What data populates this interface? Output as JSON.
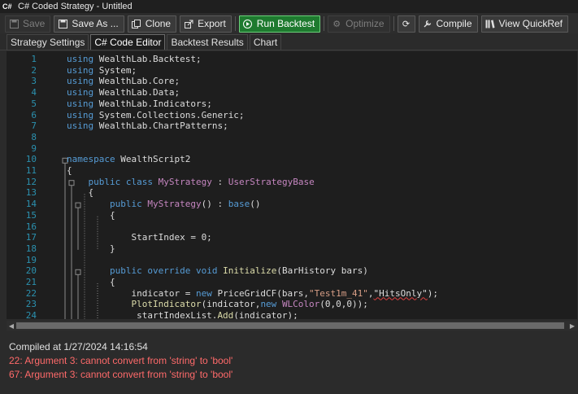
{
  "window": {
    "title": "C# Coded Strategy - Untitled",
    "icon": "csharp-app-icon"
  },
  "toolbar": {
    "save": "Save",
    "save_as": "Save As ...",
    "clone": "Clone",
    "export": "Export",
    "run_backtest": "Run Backtest",
    "optimize": "Optimize",
    "compile": "Compile",
    "view_quickref": "View QuickRef"
  },
  "tabs": [
    "Strategy Settings",
    "C# Code Editor",
    "Backtest Results",
    "Chart"
  ],
  "active_tab": "C# Code Editor",
  "code": {
    "line_numbers": [
      "1",
      "2",
      "3",
      "4",
      "5",
      "6",
      "7",
      "8",
      "9",
      "10",
      "11",
      "12",
      "13",
      "14",
      "15",
      "16",
      "17",
      "18",
      "19",
      "20",
      "21",
      "22",
      "23",
      "24"
    ],
    "lines": [
      [
        [
          "kw",
          "using"
        ],
        [
          "pu",
          " WealthLab.Backtest;"
        ]
      ],
      [
        [
          "kw",
          "using"
        ],
        [
          "pu",
          " System;"
        ]
      ],
      [
        [
          "kw",
          "using"
        ],
        [
          "pu",
          " WealthLab.Core;"
        ]
      ],
      [
        [
          "kw",
          "using"
        ],
        [
          "pu",
          " WealthLab.Data;"
        ]
      ],
      [
        [
          "kw",
          "using"
        ],
        [
          "pu",
          " WealthLab.Indicators;"
        ]
      ],
      [
        [
          "kw",
          "using"
        ],
        [
          "pu",
          " System.Collections.Generic;"
        ]
      ],
      [
        [
          "kw",
          "using"
        ],
        [
          "pu",
          " WealthLab.ChartPatterns;"
        ]
      ],
      [],
      [],
      [
        [
          "kw",
          "namespace"
        ],
        [
          "pu",
          " WealthScript2"
        ]
      ],
      [
        [
          "pu",
          "{"
        ]
      ],
      [
        [
          "pu",
          "    "
        ],
        [
          "kw",
          "public"
        ],
        [
          "pu",
          " "
        ],
        [
          "kw",
          "class"
        ],
        [
          "pu",
          " "
        ],
        [
          "ts",
          "MyStrategy"
        ],
        [
          "pu",
          " : "
        ],
        [
          "ts",
          "UserStrategyBase"
        ]
      ],
      [
        [
          "pu",
          "    {"
        ]
      ],
      [
        [
          "pu",
          "        "
        ],
        [
          "kw",
          "public"
        ],
        [
          "pu",
          " "
        ],
        [
          "ts",
          "MyStrategy"
        ],
        [
          "pu",
          "() : "
        ],
        [
          "kw",
          "base"
        ],
        [
          "pu",
          "()"
        ]
      ],
      [
        [
          "pu",
          "        {"
        ]
      ],
      [],
      [
        [
          "pu",
          "            StartIndex = 0;"
        ]
      ],
      [
        [
          "pu",
          "        }"
        ]
      ],
      [],
      [
        [
          "pu",
          "        "
        ],
        [
          "kw",
          "public"
        ],
        [
          "pu",
          " "
        ],
        [
          "kw",
          "override"
        ],
        [
          "pu",
          " "
        ],
        [
          "kw",
          "void"
        ],
        [
          "pu",
          " "
        ],
        [
          "nm",
          "Initialize"
        ],
        [
          "pu",
          "(BarHistory bars)"
        ]
      ],
      [
        [
          "pu",
          "        {"
        ]
      ],
      [
        [
          "pu",
          "            indicator = "
        ],
        [
          "kw",
          "new"
        ],
        [
          "pu",
          " PriceGridCF(bars,"
        ],
        [
          "st",
          "\"Test1m_41\""
        ],
        [
          "pu",
          ","
        ],
        [
          "sq",
          "\"HitsOnly\""
        ],
        [
          "pu",
          ");"
        ]
      ],
      [
        [
          "pu",
          "            "
        ],
        [
          "nm",
          "PlotIndicator"
        ],
        [
          "pu",
          "(indicator,"
        ],
        [
          "kw",
          "new"
        ],
        [
          "pu",
          " "
        ],
        [
          "ts",
          "WLColor"
        ],
        [
          "pu",
          "(0,0,0));"
        ]
      ],
      [
        [
          "pu",
          "             startIndexList."
        ],
        [
          "nm",
          "Add"
        ],
        [
          "pu",
          "(indicator);"
        ]
      ]
    ]
  },
  "output": {
    "compiled": "Compiled at 1/27/2024 14:16:54",
    "errors": [
      "22: Argument 3: cannot convert from 'string' to 'bool'",
      "67: Argument 3: cannot convert from 'string' to 'bool'"
    ]
  },
  "colors": {
    "run_button": "#1e7a2f",
    "error_text": "#ff6a6a",
    "keyword": "#569cd6",
    "line_number": "#2b91af"
  }
}
